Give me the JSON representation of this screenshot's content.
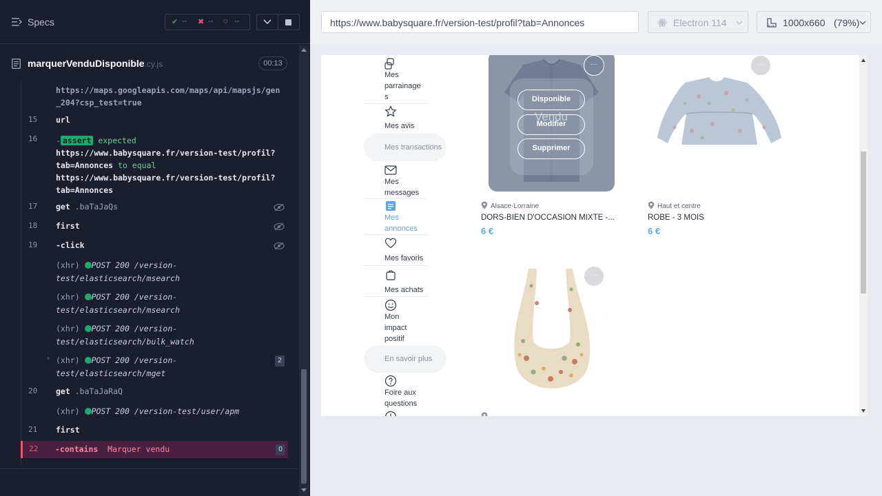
{
  "reporter": {
    "specs_label": "Specs",
    "stats": {
      "passed": "--",
      "failed": "--",
      "pending": "--"
    },
    "spec_file": {
      "name": "marquerVenduDisponible",
      "ext": ".cy.js",
      "duration": "00:13"
    },
    "commands": {
      "c14_url": "https://maps.googleapis.com/maps/api/mapsjs/gen",
      "c14_url2": "_204?csp_test=true",
      "c15": {
        "num": "15",
        "name": "url"
      },
      "c16": {
        "num": "16",
        "badge": "assert",
        "expected": "expected",
        "url1": "https://www.babysquare.fr/version-test/profil?",
        "url1b": "tab=Annonces",
        "to_equal": "to equal",
        "url2": "https://www.babysquare.fr/version-test/profil?",
        "url2b": "tab=Annonces"
      },
      "c17": {
        "num": "17",
        "name": "get",
        "msg": ".baTaJaQs"
      },
      "c18": {
        "num": "18",
        "name": "first"
      },
      "c19": {
        "num": "19",
        "name": "-click"
      },
      "xhr1": {
        "tag": "(xhr)",
        "method": "POST 200 /version-",
        "path": "test/elasticsearch/msearch"
      },
      "xhr2": {
        "tag": "(xhr)",
        "method": "POST 200 /version-",
        "path": "test/elasticsearch/msearch"
      },
      "xhr3": {
        "tag": "(xhr)",
        "method": "POST 200 /version-",
        "path": "test/elasticsearch/bulk_watch"
      },
      "xhr4": {
        "tag": "(xhr)",
        "method": "POST 200 /version-",
        "path": "test/elasticsearch/mget",
        "count": "2"
      },
      "c20": {
        "num": "20",
        "name": "get",
        "msg": ".baTaJaRaQ"
      },
      "xhr5": {
        "tag": "(xhr)",
        "method": "POST 200 /version-test/user/apm"
      },
      "c21": {
        "num": "21",
        "name": "first"
      },
      "c22": {
        "num": "22",
        "name": "-contains",
        "msg": "Marquer vendu",
        "count": "0"
      }
    }
  },
  "aut": {
    "url": "https://www.babysquare.fr/version-test/profil?tab=Annonces",
    "browser": "Electron 114",
    "viewport": "1000x660",
    "zoom": "(79%)"
  },
  "sidebar": {
    "items": [
      {
        "label_lines": [
          "Mes",
          "parrainage",
          "s"
        ],
        "icon": "sponsorship-icon"
      },
      {
        "label_lines": [
          "Mes avis"
        ],
        "icon": "star-icon"
      },
      {
        "pill": "Mes transactions"
      },
      {
        "label_lines": [
          "Mes",
          "messages"
        ],
        "icon": "mail-icon"
      },
      {
        "label_lines": [
          "Mes",
          "annonces"
        ],
        "icon": "listings-icon",
        "active": true
      },
      {
        "label_lines": [
          "Mes favoris"
        ],
        "icon": "heart-icon"
      },
      {
        "label_lines": [
          "Mes achats"
        ],
        "icon": "bag-icon"
      },
      {
        "label_lines": [
          "Mon",
          "impact",
          "positif"
        ],
        "icon": "smile-icon"
      },
      {
        "pill": "En savoir plus"
      },
      {
        "label_lines": [
          "Foire aux",
          "questions"
        ],
        "icon": "help-icon"
      }
    ]
  },
  "listings": [
    {
      "location": "Alsace-Lorraine",
      "title": "DORS-BIEN D'OCCASION MIXTE -...",
      "price": "6 €",
      "overlay": {
        "sold_text": "Vendu",
        "btn1": "Disponible",
        "btn2": "Modifier",
        "btn3": "Supprimer"
      }
    },
    {
      "location": "Haut et centre",
      "title": "ROBE - 3 MOIS",
      "price": "6 €"
    },
    {
      "location": ""
    }
  ],
  "more_label": "···",
  "colors": {
    "accent": "#5aa9e6",
    "pass": "#1fa971",
    "fail": "#e45770",
    "reporter_bg": "#1b1e2e"
  }
}
